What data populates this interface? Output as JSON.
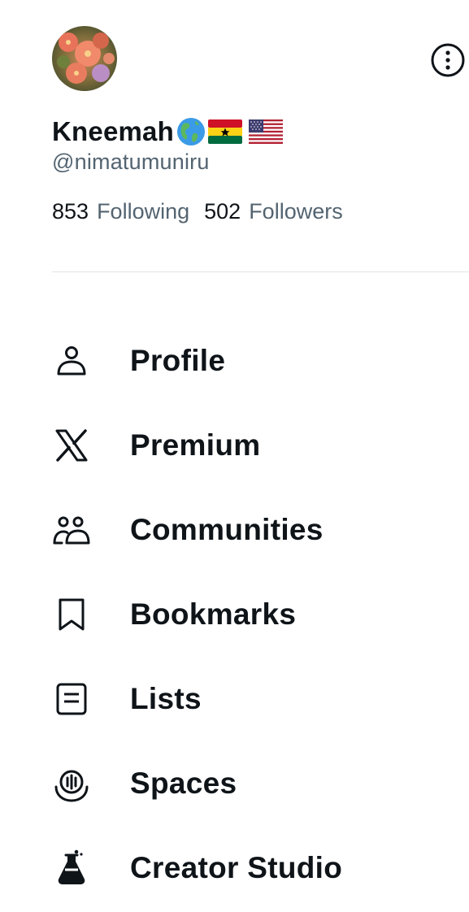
{
  "profile": {
    "display_name": "Kneemah",
    "name_emojis": [
      "globe-americas-icon",
      "ghana-flag-icon",
      "us-flag-icon"
    ],
    "handle": "@nimatumuniru",
    "following_count": "853",
    "following_label": "Following",
    "followers_count": "502",
    "followers_label": "Followers"
  },
  "menu": {
    "items": [
      {
        "label": "Profile",
        "icon": "person-icon"
      },
      {
        "label": "Premium",
        "icon": "x-logo-icon"
      },
      {
        "label": "Communities",
        "icon": "communities-icon"
      },
      {
        "label": "Bookmarks",
        "icon": "bookmark-icon"
      },
      {
        "label": "Lists",
        "icon": "list-icon"
      },
      {
        "label": "Spaces",
        "icon": "spaces-icon"
      },
      {
        "label": "Creator Studio",
        "icon": "creator-studio-icon"
      }
    ]
  },
  "colors": {
    "text_primary": "#0f1419",
    "text_secondary": "#536471",
    "divider": "#dfe3e6",
    "background": "#ffffff"
  }
}
